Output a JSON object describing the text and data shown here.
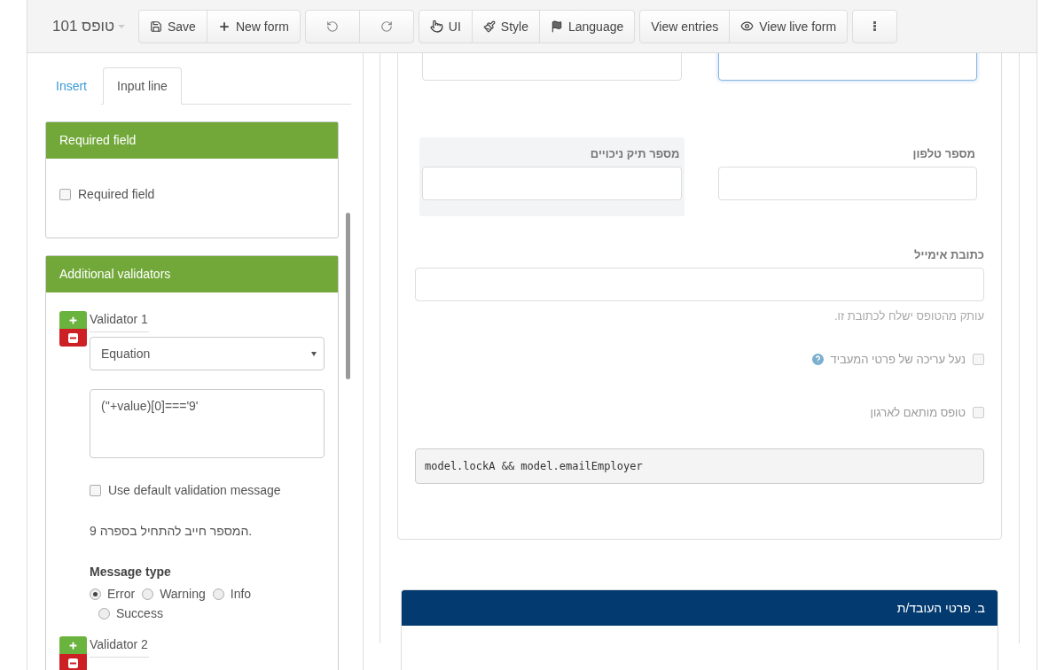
{
  "toolbar": {
    "title": "101 טופס",
    "groups": [
      [
        {
          "label": "Save",
          "kind": "save"
        },
        {
          "label": "New form",
          "kind": "plus"
        }
      ],
      [
        {
          "kind": "undo"
        },
        {
          "kind": "redo"
        }
      ],
      [
        {
          "label": "UI",
          "kind": "hand"
        },
        {
          "label": "Style",
          "kind": "brush"
        },
        {
          "label": "Language",
          "kind": "flag"
        }
      ],
      [
        {
          "label": "View entries",
          "kind": "text"
        },
        {
          "label": "View live form",
          "kind": "eye"
        }
      ],
      [
        {
          "kind": "more"
        }
      ]
    ]
  },
  "sidebar": {
    "tabs": [
      {
        "label": "Insert",
        "selected": false
      },
      {
        "label": "Input line",
        "selected": true
      }
    ],
    "required_panel": {
      "title": "Required field",
      "checkbox": {
        "label": "Required field",
        "checked": false
      }
    },
    "validators_panel": {
      "title": "Additional validators",
      "validators": [
        {
          "label": "Validator 1",
          "type": "Equation",
          "expression": "(''+value)[0]==='9'",
          "use_default": {
            "label": "Use default validation message",
            "checked": false
          },
          "message": "המספר חייב להתחיל בספרה 9.",
          "message_type_label": "Message type",
          "message_types": [
            {
              "label": "Error",
              "selected": true
            },
            {
              "label": "Warning",
              "selected": false
            },
            {
              "label": "Info",
              "selected": false
            },
            {
              "label": "Success",
              "selected": false
            }
          ]
        },
        {
          "label": "Validator 2"
        }
      ]
    }
  },
  "form": {
    "top_fields": [
      {
        "focused": true
      },
      {
        "focused": false
      }
    ],
    "fields": [
      {
        "label": "מספר טלפון",
        "highlighted": false
      },
      {
        "label": "מספר תיק ניכויים",
        "highlighted": true
      }
    ],
    "email": {
      "label": "כתובת אימייל",
      "help": "עותק מהטופס ישלח לכתובת זו."
    },
    "checkboxes": [
      {
        "label": "נעל עריכה של פרטי המעביד",
        "checked": false,
        "help_icon": true
      },
      {
        "label": "טופס מותאם לארגון",
        "checked": false,
        "help_icon": false
      }
    ],
    "condition": "model.lockA && model.emailEmployer"
  },
  "section": {
    "title": "ב. פרטי העובד/ת"
  }
}
